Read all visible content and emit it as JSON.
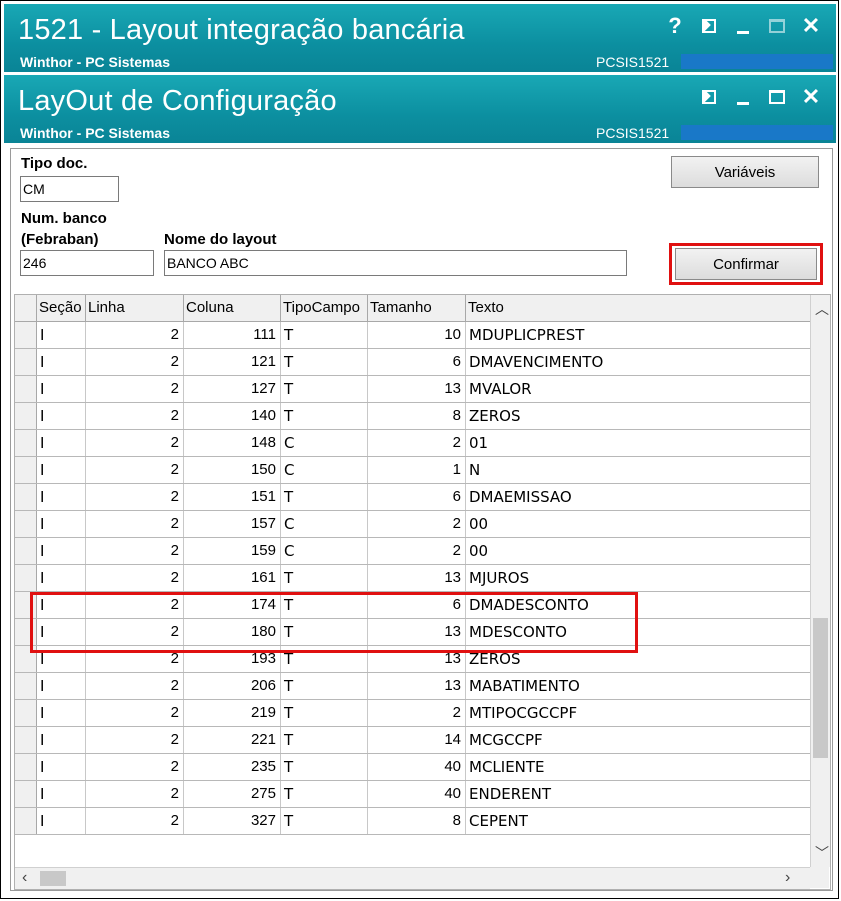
{
  "outer_window": {
    "title": "1521 - Layout integração bancária",
    "subtitle": "Winthor - PC Sistemas",
    "code": "PCSIS1521",
    "controls": {
      "help": "?",
      "close": "✕"
    }
  },
  "inner_window": {
    "title": "LayOut de Configuração",
    "subtitle": "Winthor - PC Sistemas",
    "code": "PCSIS1521",
    "controls": {
      "close": "✕"
    }
  },
  "form": {
    "tipo_doc_label": "Tipo doc.",
    "tipo_doc_value": "CM",
    "num_banco_label_1": "Num. banco",
    "num_banco_label_2": "(Febraban)",
    "num_banco_value": "246",
    "nome_layout_label": "Nome do layout",
    "nome_layout_value": "BANCO ABC",
    "variaveis_button": "Variáveis",
    "confirmar_button": "Confirmar"
  },
  "grid": {
    "columns": [
      "Seção",
      "Linha",
      "Coluna",
      "TipoCampo",
      "Tamanho",
      "Texto"
    ],
    "rows": [
      [
        "I",
        "2",
        "111",
        "T",
        "10",
        "MDUPLICPREST"
      ],
      [
        "I",
        "2",
        "121",
        "T",
        "6",
        "DMAVENCIMENTO"
      ],
      [
        "I",
        "2",
        "127",
        "T",
        "13",
        "MVALOR"
      ],
      [
        "I",
        "2",
        "140",
        "T",
        "8",
        "ZEROS"
      ],
      [
        "I",
        "2",
        "148",
        "C",
        "2",
        "01"
      ],
      [
        "I",
        "2",
        "150",
        "C",
        "1",
        "N"
      ],
      [
        "I",
        "2",
        "151",
        "T",
        "6",
        "DMAEMISSAO"
      ],
      [
        "I",
        "2",
        "157",
        "C",
        "2",
        "00"
      ],
      [
        "I",
        "2",
        "159",
        "C",
        "2",
        "00"
      ],
      [
        "I",
        "2",
        "161",
        "T",
        "13",
        "MJUROS"
      ],
      [
        "I",
        "2",
        "174",
        "T",
        "6",
        "DMADESCONTO"
      ],
      [
        "I",
        "2",
        "180",
        "T",
        "13",
        "MDESCONTO"
      ],
      [
        "I",
        "2",
        "193",
        "T",
        "13",
        "ZEROS"
      ],
      [
        "I",
        "2",
        "206",
        "T",
        "13",
        "MABATIMENTO"
      ],
      [
        "I",
        "2",
        "219",
        "T",
        "2",
        "MTIPOCGCCPF"
      ],
      [
        "I",
        "2",
        "221",
        "T",
        "14",
        "MCGCCPF"
      ],
      [
        "I",
        "2",
        "235",
        "T",
        "40",
        "MCLIENTE"
      ],
      [
        "I",
        "2",
        "275",
        "T",
        "40",
        "ENDERENT"
      ],
      [
        "I",
        "2",
        "327",
        "T",
        "8",
        "CEPENT"
      ]
    ]
  },
  "colors": {
    "titlebar": "#0f95a6",
    "highlight": "#e01010",
    "code_bar": "#1978c8"
  }
}
